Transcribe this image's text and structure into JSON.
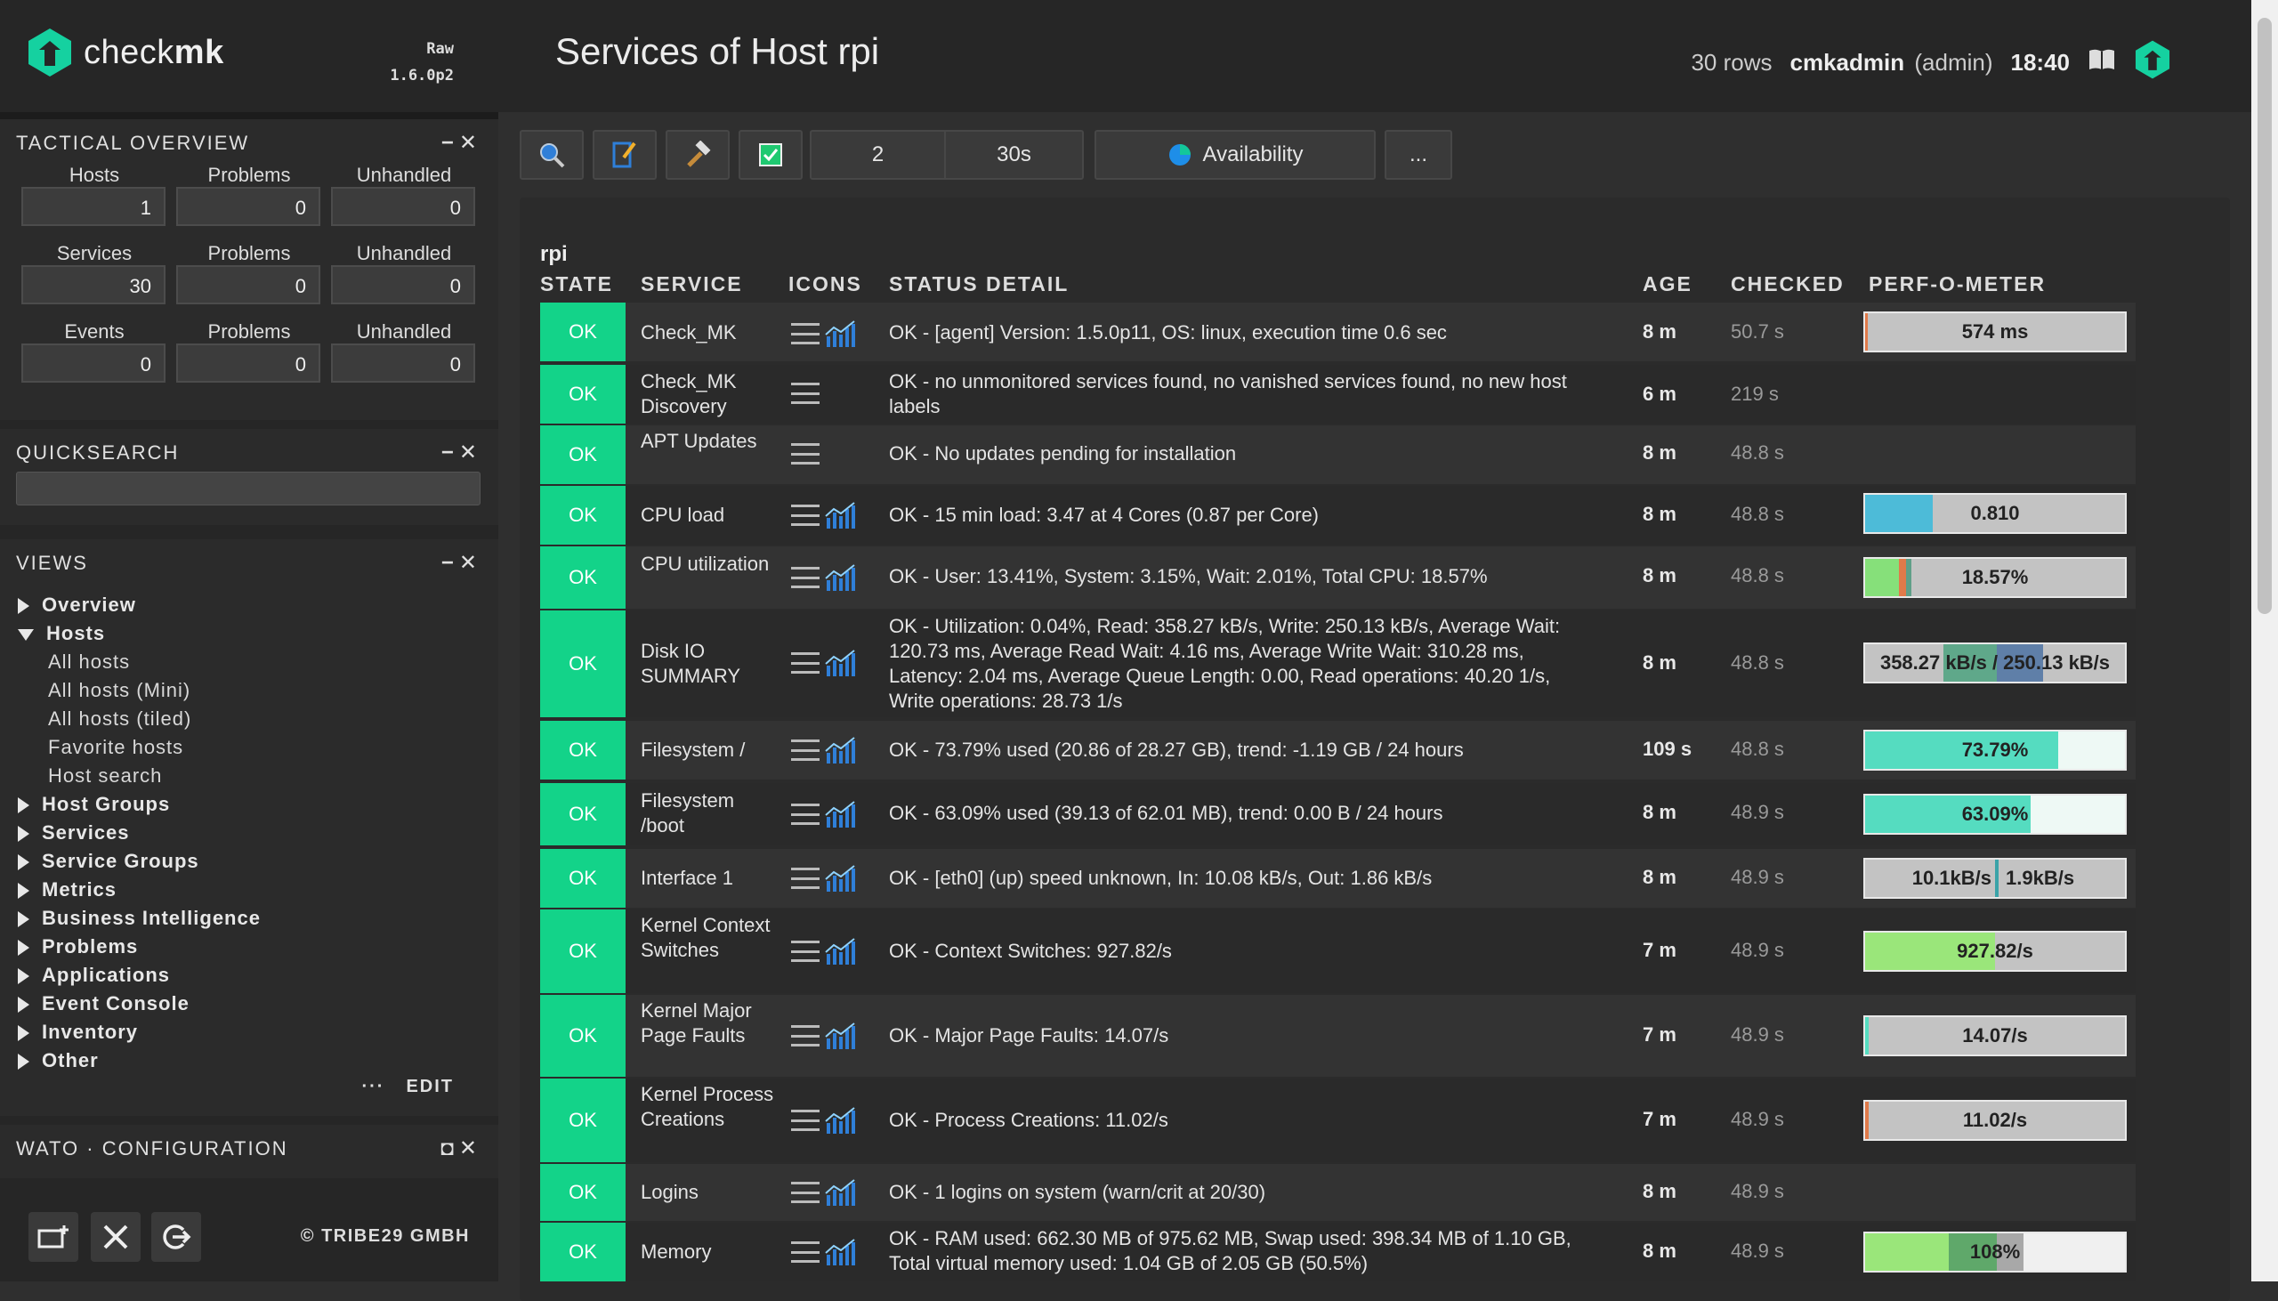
{
  "brand": {
    "name_light": "check",
    "name_bold": "mk",
    "edition_line1": "Raw",
    "edition_line2": "1.6.0p2"
  },
  "tactical": {
    "title": "TACTICAL OVERVIEW",
    "rows": [
      {
        "label": "Hosts",
        "count": "1",
        "problems_label": "Problems",
        "problems": "0",
        "unhandled_label": "Unhandled",
        "unhandled": "0"
      },
      {
        "label": "Services",
        "count": "30",
        "problems_label": "Problems",
        "problems": "0",
        "unhandled_label": "Unhandled",
        "unhandled": "0"
      },
      {
        "label": "Events",
        "count": "0",
        "problems_label": "Problems",
        "problems": "0",
        "unhandled_label": "Unhandled",
        "unhandled": "0"
      }
    ]
  },
  "quicksearch": {
    "title": "QUICKSEARCH",
    "placeholder": ""
  },
  "views": {
    "title": "VIEWS",
    "items": [
      "Overview",
      "Hosts",
      "All hosts",
      "All hosts (Mini)",
      "All hosts (tiled)",
      "Favorite hosts",
      "Host search",
      "Host Groups",
      "Services",
      "Service Groups",
      "Metrics",
      "Business Intelligence",
      "Problems",
      "Applications",
      "Event Console",
      "Inventory",
      "Other"
    ],
    "more": "···",
    "edit": "EDIT"
  },
  "wato": {
    "title": "WATO · CONFIGURATION"
  },
  "footer": {
    "copyright": "© TRIBE29 GMBH"
  },
  "header": {
    "title": "Services of Host rpi",
    "rows": "30 rows",
    "user": "cmkadmin",
    "role": "(admin)",
    "time": "18:40"
  },
  "toolbar": {
    "count": "2",
    "refresh": "30s",
    "availability": "Availability",
    "more": "..."
  },
  "table": {
    "host": "rpi",
    "headers": {
      "state": "STATE",
      "service": "SERVICE",
      "icons": "ICONS",
      "detail": "STATUS DETAIL",
      "age": "AGE",
      "checked": "CHECKED",
      "perf": "PERF-O-METER"
    },
    "rows": [
      {
        "state": "OK",
        "service": "Check_MK",
        "detail": "OK - [agent] Version: 1.5.0p11, OS: linux, execution time 0.6 sec",
        "age": "8 m",
        "checked": "50.7 s",
        "perf": "574 ms"
      },
      {
        "state": "OK",
        "service": "Check_MK Discovery",
        "detail": "OK - no unmonitored services found, no vanished services found, no new host labels",
        "age": "6 m",
        "checked": "219 s",
        "perf": ""
      },
      {
        "state": "OK",
        "service": "APT Updates",
        "detail": "OK - No updates pending for installation",
        "age": "8 m",
        "checked": "48.8 s",
        "perf": ""
      },
      {
        "state": "OK",
        "service": "CPU load",
        "detail": "OK - 15 min load: 3.47 at 4 Cores (0.87 per Core)",
        "age": "8 m",
        "checked": "48.8 s",
        "perf": "0.810"
      },
      {
        "state": "OK",
        "service": "CPU utilization",
        "detail": "OK - User: 13.41%, System: 3.15%, Wait: 2.01%, Total CPU: 18.57%",
        "age": "8 m",
        "checked": "48.8 s",
        "perf": "18.57%"
      },
      {
        "state": "OK",
        "service": "Disk IO SUMMARY",
        "detail": "OK - Utilization: 0.04%, Read: 358.27 kB/s, Write: 250.13 kB/s, Average Wait: 120.73 ms, Average Read Wait: 4.16 ms, Average Write Wait: 310.28 ms, Latency: 2.04 ms, Average Queue Length: 0.00, Read operations: 40.20 1/s, Write operations: 28.73 1/s",
        "age": "8 m",
        "checked": "48.8 s",
        "perf": "358.27 kB/s / 250.13 kB/s"
      },
      {
        "state": "OK",
        "service": "Filesystem /",
        "detail": "OK - 73.79% used (20.86 of 28.27 GB), trend: -1.19 GB / 24 hours",
        "age": "109 s",
        "checked": "48.8 s",
        "perf": "73.79%"
      },
      {
        "state": "OK",
        "service": "Filesystem /boot",
        "detail": "OK - 63.09% used (39.13 of 62.01 MB), trend: 0.00 B / 24 hours",
        "age": "8 m",
        "checked": "48.9 s",
        "perf": "63.09%"
      },
      {
        "state": "OK",
        "service": "Interface 1",
        "detail": "OK - [eth0] (up) speed unknown, In: 10.08 kB/s, Out: 1.86 kB/s",
        "age": "8 m",
        "checked": "48.9 s",
        "perf_in": "10.1kB/s",
        "perf_out": "1.9kB/s"
      },
      {
        "state": "OK",
        "service": "Kernel Context Switches",
        "detail": "OK - Context Switches: 927.82/s",
        "age": "7 m",
        "checked": "48.9 s",
        "perf": "927.82/s"
      },
      {
        "state": "OK",
        "service": "Kernel Major Page Faults",
        "detail": "OK - Major Page Faults: 14.07/s",
        "age": "7 m",
        "checked": "48.9 s",
        "perf": "14.07/s"
      },
      {
        "state": "OK",
        "service": "Kernel Process Creations",
        "detail": "OK - Process Creations: 11.02/s",
        "age": "7 m",
        "checked": "48.9 s",
        "perf": "11.02/s"
      },
      {
        "state": "OK",
        "service": "Logins",
        "detail": "OK - 1 logins on system (warn/crit at 20/30)",
        "age": "8 m",
        "checked": "48.9 s",
        "perf": ""
      },
      {
        "state": "OK",
        "service": "Memory",
        "detail": "OK - RAM used: 662.30 MB of 975.62 MB, Swap used: 398.34 MB of 1.10 GB, Total virtual memory used: 1.04 GB of 2.05 GB (50.5%)",
        "age": "8 m",
        "checked": "48.9 s",
        "perf": "108%"
      }
    ]
  },
  "colors": {
    "ok": "#13d389",
    "brand": "#15d1a0"
  }
}
